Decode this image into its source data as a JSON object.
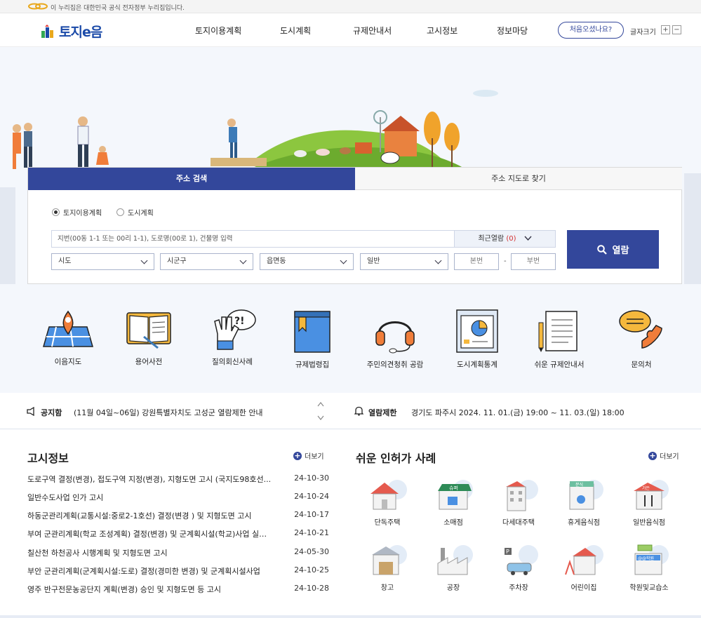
{
  "gov_banner": {
    "text": "이 누리집은 대한민국 공식 전자정부 누리집입니다."
  },
  "header": {
    "logo": "토지e음",
    "nav": [
      "토지이용계획",
      "도시계획",
      "규제안내서",
      "고시정보",
      "정보마당"
    ],
    "first_visit": "처음오셨나요?",
    "font_size_label": "글자크기",
    "font_plus": "+",
    "font_minus": "−"
  },
  "search": {
    "tabs": [
      "주소 검색",
      "주소 지도로 찾기"
    ],
    "radios": [
      {
        "label": "토지이용계획",
        "checked": true
      },
      {
        "label": "도시계획",
        "checked": false
      }
    ],
    "address_placeholder": "지번(00동 1-1 또는 00리 1-1), 도로명(00로 1), 건물명 입력",
    "recent_label": "최근열람",
    "recent_count": "(0)",
    "selects": [
      "시도",
      "시군구",
      "읍면동",
      "일반"
    ],
    "bonbun": "본번",
    "dash": "-",
    "bubun": "부번",
    "button": "열람"
  },
  "quick_links": [
    "이음지도",
    "용어사전",
    "질의회신사례",
    "규제법령집",
    "주민의견청취 공람",
    "도시계획통계",
    "쉬운 규제안내서",
    "문의처"
  ],
  "notice": {
    "label": "공지함",
    "text": "(11월 04일~06일) 강원특별자치도 고성군 열람제한 안내",
    "restrict_label": "열람제한",
    "restrict_text": "경기도 파주시 2024. 11. 01.(금) 19:00 ~ 11. 03.(일) 18:00"
  },
  "gosi": {
    "title": "고시정보",
    "more": "더보기",
    "items": [
      {
        "title": "도로구역 결정(변경), 접도구역 지정(변경), 지형도면 고시 (국지도98호선...",
        "date": "24-10-30"
      },
      {
        "title": "일반수도사업 인가 고시",
        "date": "24-10-24"
      },
      {
        "title": "하동군관리계획(교통시설:중로2-1호선) 결정(변경 ) 및 지형도면 고시",
        "date": "24-10-17"
      },
      {
        "title": "부여 군관리계획(학교 조성계획) 결정(변경) 및 군계획시설(학교)사업 실시계획",
        "date": "24-10-21"
      },
      {
        "title": "칠산천 하천공사 시행계획 및 지형도면 고시",
        "date": "24-05-30"
      },
      {
        "title": "부안 군관리계획(군계획시설:도로) 결정(경미한 변경) 및 군계획시설사업",
        "date": "24-10-25"
      },
      {
        "title": "영주 반구전문농공단지 계획(변경) 승인 및 지형도면 등 고시",
        "date": "24-10-28"
      }
    ]
  },
  "cases": {
    "title": "쉬운 인허가 사례",
    "more": "더보기",
    "items": [
      "단독주택",
      "소매점",
      "다세대주택",
      "휴게음식점",
      "일반음식점",
      "창고",
      "공장",
      "주차장",
      "어린이집",
      "학원및교습소"
    ],
    "sign_texts": [
      "슈퍼",
      "분식",
      "가든",
      "@@학원"
    ]
  }
}
